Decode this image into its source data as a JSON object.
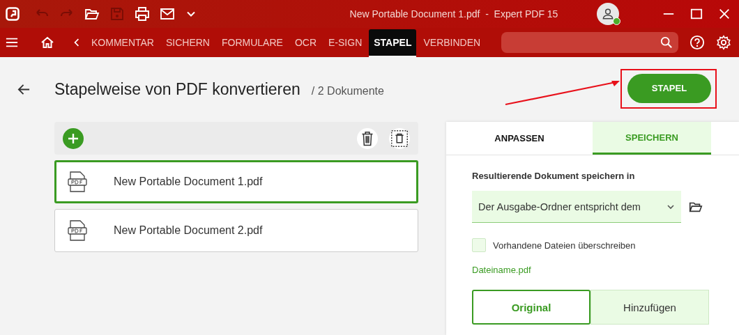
{
  "window": {
    "title": "New Portable Document 1.pdf  -  Expert PDF 15"
  },
  "toolbar": {
    "tabs": [
      {
        "label": "KOMMENTAR",
        "selected": false
      },
      {
        "label": "SICHERN",
        "selected": false
      },
      {
        "label": "FORMULARE",
        "selected": false
      },
      {
        "label": "OCR",
        "selected": false
      },
      {
        "label": "E-SIGN",
        "selected": false
      },
      {
        "label": "STAPEL",
        "selected": true
      },
      {
        "label": "VERBINDEN",
        "selected": false
      }
    ]
  },
  "page": {
    "title": "Stapelweise von PDF konvertieren",
    "subtitle": "/ 2 Dokumente",
    "primary_button": "STAPEL"
  },
  "documents": [
    {
      "name": "New Portable Document 1.pdf",
      "selected": true
    },
    {
      "name": "New Portable Document 2.pdf",
      "selected": false
    }
  ],
  "panel": {
    "tabs": [
      {
        "label": "ANPASSEN",
        "selected": false
      },
      {
        "label": "SPEICHERN",
        "selected": true
      }
    ],
    "save_label": "Resultierende Dokument speichern in",
    "folder_select": "Der Ausgabe-Ordner entspricht dem",
    "overwrite": {
      "label": "Vorhandene Dateien überschreiben",
      "checked": false
    },
    "filename_link": "Dateiname.pdf",
    "name_modes": [
      {
        "label": "Original",
        "selected": true
      },
      {
        "label": "Hinzufügen",
        "selected": false
      }
    ]
  }
}
